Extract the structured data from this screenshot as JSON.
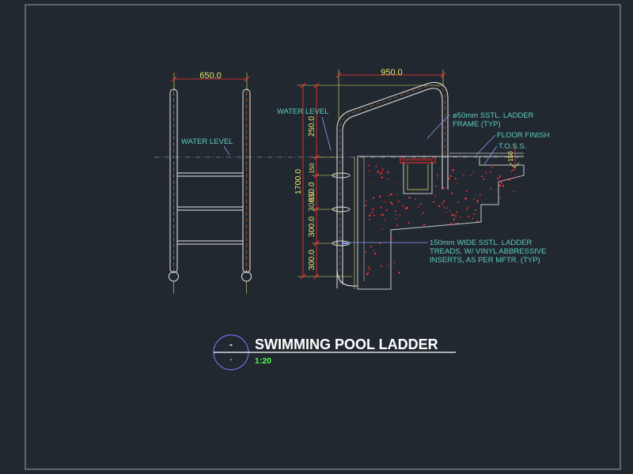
{
  "colors": {
    "background": "#212830",
    "border": "#9aa0a6",
    "ladder": "#e8e8e8",
    "yellow_dim": "#e6e66a",
    "red": "#ff3030",
    "cyan_text": "#5fcfc0",
    "concrete": "#c8c8c8",
    "water_line": "#8a8f95",
    "title": "#ffffff",
    "scale": "#4cff4c",
    "circle": "#7b7bff",
    "orange": "#ff7a1a"
  },
  "front_view": {
    "width_dim": "650.0",
    "water_level_label": "WATER LEVEL"
  },
  "section_view": {
    "width_dim": "950.0",
    "water_level_label": "WATER LEVEL",
    "dim_250": "250.0",
    "dim_1700": "1700.0",
    "dim_top_tread": "300.0",
    "dim_mid_tread": "300.0",
    "dim_bottom": "300.0",
    "dim_small": "150",
    "dim_overlap": "850.0"
  },
  "callouts": {
    "frame_line1": "ø50mm SSTL. LADDER",
    "frame_line2": "FRAME (TYP)",
    "floor_finish": "FLOOR FINISH",
    "toss": "T.O.S.S.",
    "treads_line1": "150mm WIDE SSTL. LADDER",
    "treads_line2": "TREADS, W/ VINYL ABBRESSIVE",
    "treads_line3": "INSERTS, AS PER MFTR. (TYP)"
  },
  "title_block": {
    "bubble_top": "-",
    "bubble_bottom": "-",
    "title": "SWIMMING POOL LADDER",
    "scale": "1:20"
  }
}
